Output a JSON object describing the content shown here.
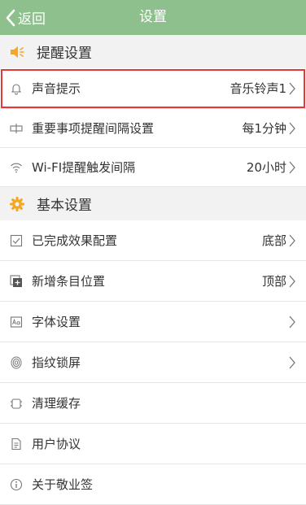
{
  "header": {
    "back_label": "返回",
    "title": "设置"
  },
  "sections": {
    "reminder": {
      "title": "提醒设置"
    },
    "basic": {
      "title": "基本设置"
    }
  },
  "rows": {
    "sound": {
      "label": "声音提示",
      "value": "音乐铃声1"
    },
    "interval": {
      "label": "重要事项提醒间隔设置",
      "value": "每1分钟"
    },
    "wifi": {
      "label": "Wi-FI提醒触发间隔",
      "value": "20小时"
    },
    "done_effect": {
      "label": "已完成效果配置",
      "value": "底部"
    },
    "new_position": {
      "label": "新增条目位置",
      "value": "顶部"
    },
    "font": {
      "label": "字体设置"
    },
    "fingerprint": {
      "label": "指纹锁屏"
    },
    "cache": {
      "label": "清理缓存"
    },
    "agreement": {
      "label": "用户协议"
    },
    "about": {
      "label": "关于敬业签"
    }
  },
  "colors": {
    "header_bg": "#8dc08d",
    "accent_orange": "#f5a623",
    "highlight_border": "#e53935"
  }
}
